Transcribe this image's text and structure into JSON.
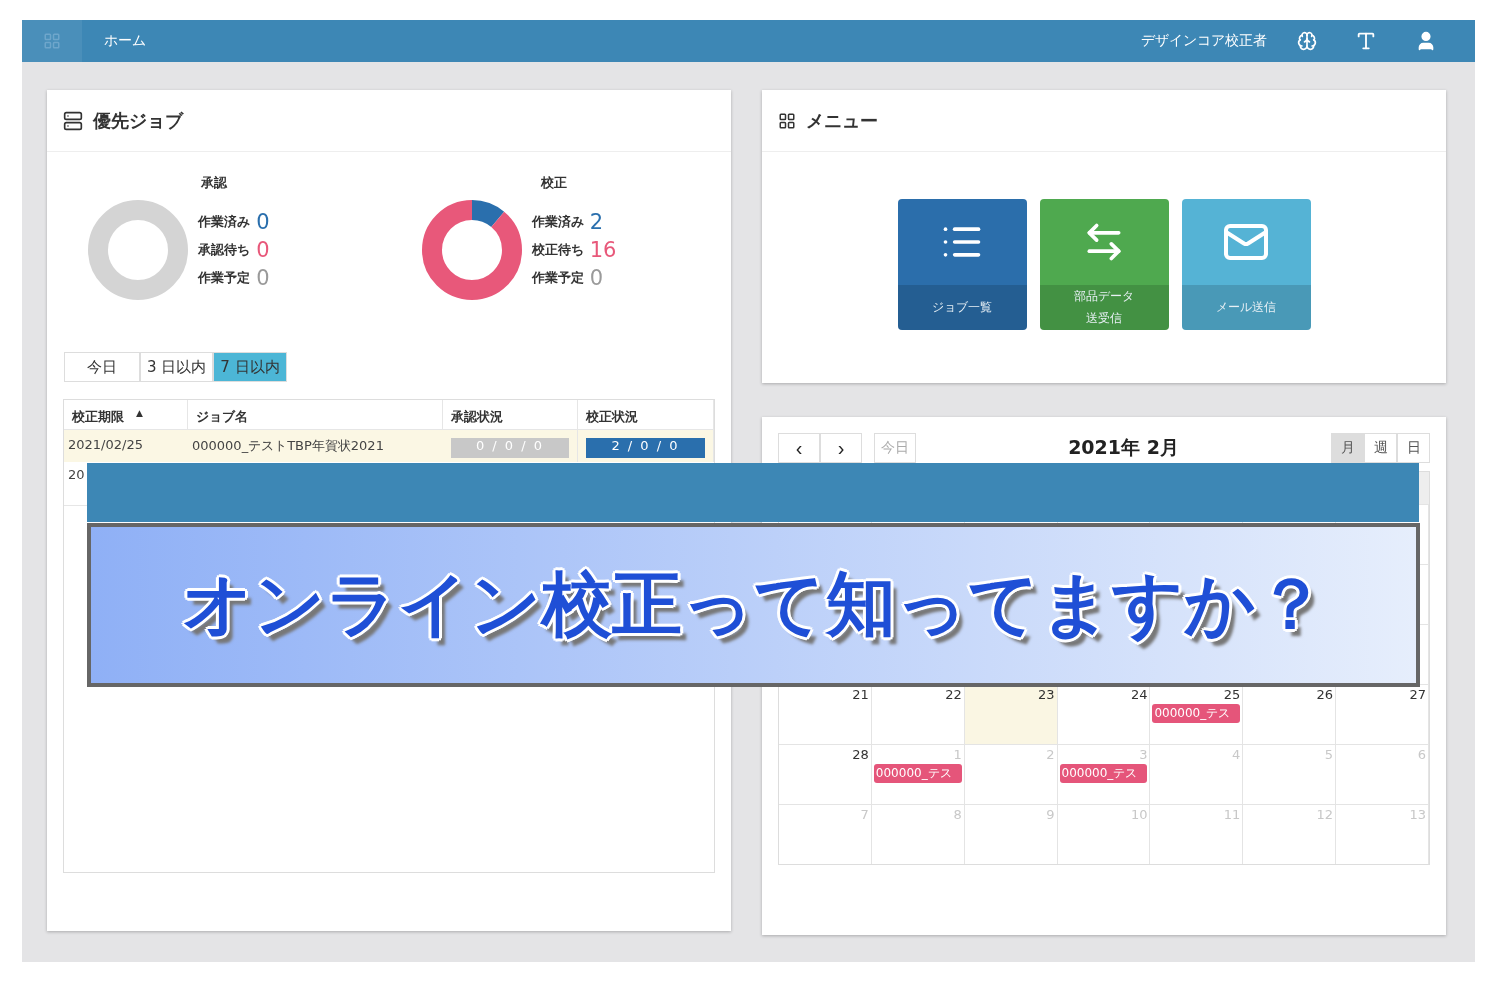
{
  "topbar": {
    "home": "ホーム",
    "user": "デザインコア校正者"
  },
  "priority_jobs": {
    "title": "優先ジョブ",
    "summaries": [
      {
        "title": "承認",
        "stats": [
          {
            "label": "作業済み",
            "value": "0",
            "color": "#2a6fad"
          },
          {
            "label": "承認待ち",
            "value": "0",
            "color": "#e8587a"
          },
          {
            "label": "作業予定",
            "value": "0",
            "color": "#9a9a9a"
          }
        ]
      },
      {
        "title": "校正",
        "stats": [
          {
            "label": "作業済み",
            "value": "2",
            "color": "#2a6fad"
          },
          {
            "label": "校正待ち",
            "value": "16",
            "color": "#e8587a"
          },
          {
            "label": "作業予定",
            "value": "0",
            "color": "#9a9a9a"
          }
        ]
      }
    ],
    "ranges": [
      {
        "label": "今日",
        "selected": false
      },
      {
        "label": "3 日以内",
        "selected": false
      },
      {
        "label": "7 日以内",
        "selected": true
      }
    ],
    "table": {
      "columns": [
        {
          "label": "校正期限",
          "sort": "▲"
        },
        {
          "label": "ジョブ名"
        },
        {
          "label": "承認状況"
        },
        {
          "label": "校正状況"
        }
      ],
      "rows": [
        {
          "deadline": "2021/02/25",
          "job": "000000_テストTBP年賀状2021",
          "approval": {
            "text": "0 / 0 / 0",
            "color": "#c8c8c8"
          },
          "proof": {
            "text": "2 / 0 / 0",
            "color": "#2a6fad"
          },
          "highlighted": true
        },
        {
          "deadline": "20",
          "highlighted": false
        }
      ]
    }
  },
  "menu": {
    "title": "メニュー",
    "tiles": [
      {
        "kind": "list",
        "label": [
          "ジョブ一覧"
        ],
        "color": "#2b6eab"
      },
      {
        "kind": "transfer",
        "label": [
          "部品データ",
          "送受信"
        ],
        "color": "#4fa94f"
      },
      {
        "kind": "mail",
        "label": [
          "メール送信"
        ],
        "color": "#55b3d5"
      }
    ]
  },
  "calendar": {
    "prev": "‹",
    "next": "›",
    "today": "今日",
    "title": "2021年 2月",
    "views": [
      {
        "label": "月",
        "selected": true
      },
      {
        "label": "週",
        "selected": false
      },
      {
        "label": "日",
        "selected": false
      }
    ],
    "weeks": [
      [
        {
          "day": "21",
          "muted": false,
          "today": false
        },
        {
          "day": "22",
          "muted": false,
          "today": false
        },
        {
          "day": "23",
          "muted": false,
          "today": true
        },
        {
          "day": "24",
          "muted": false,
          "today": false
        },
        {
          "day": "25",
          "muted": false,
          "today": false,
          "events": [
            "000000_テス"
          ]
        },
        {
          "day": "26",
          "muted": false,
          "today": false
        },
        {
          "day": "27",
          "muted": false,
          "today": false
        }
      ],
      [
        {
          "day": "28",
          "muted": false,
          "today": false
        },
        {
          "day": "1",
          "muted": true,
          "today": false,
          "events": [
            "000000_テス"
          ]
        },
        {
          "day": "2",
          "muted": true,
          "today": false
        },
        {
          "day": "3",
          "muted": true,
          "today": false,
          "events": [
            "000000_テス"
          ]
        },
        {
          "day": "4",
          "muted": true,
          "today": false
        },
        {
          "day": "5",
          "muted": true,
          "today": false
        },
        {
          "day": "6",
          "muted": true,
          "today": false
        }
      ],
      [
        {
          "day": "7",
          "muted": true,
          "today": false
        },
        {
          "day": "8",
          "muted": true,
          "today": false
        },
        {
          "day": "9",
          "muted": true,
          "today": false
        },
        {
          "day": "10",
          "muted": true,
          "today": false
        },
        {
          "day": "11",
          "muted": true,
          "today": false
        },
        {
          "day": "12",
          "muted": true,
          "today": false
        },
        {
          "day": "13",
          "muted": true,
          "today": false
        }
      ]
    ]
  },
  "banner": {
    "text": "オンライン校正って知ってますか？"
  }
}
